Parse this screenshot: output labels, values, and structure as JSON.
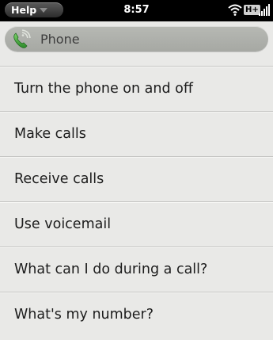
{
  "status_bar": {
    "app_menu_label": "Help",
    "time": "8:57",
    "network_type": "H+",
    "icons": [
      "wifi-icon",
      "signal-strength-icon"
    ]
  },
  "header": {
    "title": "Phone",
    "icon": "phone-icon"
  },
  "topics": [
    {
      "label": "Turn the phone on and off"
    },
    {
      "label": "Make calls"
    },
    {
      "label": "Receive calls"
    },
    {
      "label": "Use voicemail"
    },
    {
      "label": "What can I do during a call?"
    },
    {
      "label": "What's my number?"
    }
  ],
  "colors": {
    "status_bar": "#000000",
    "header": "#afb1ac",
    "list_background": "#e9e9e7",
    "phone_icon_green": "#3fa23a"
  }
}
